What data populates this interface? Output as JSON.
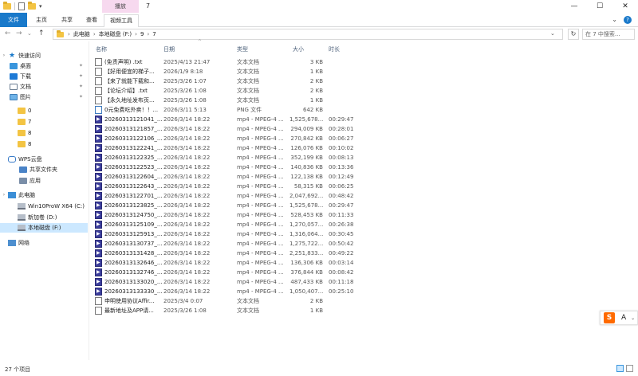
{
  "window": {
    "title": "7",
    "minimize": "—",
    "maximize": "☐",
    "close": "✕"
  },
  "ribbon": {
    "file_tab": "文件",
    "home_tab": "主页",
    "share_tab": "共享",
    "view_tab": "查看",
    "context_group": "播放",
    "video_tools_tab": "视频工具",
    "collapse": "⌄",
    "help": "?"
  },
  "address": {
    "back": "←",
    "forward": "→",
    "recent": "⌄",
    "up": "↑",
    "crumbs": [
      "此电脑",
      "本地磁盘 (F:)",
      "9",
      "7"
    ],
    "dropdown": "⌄",
    "refresh": "↻",
    "search_placeholder": "在 7 中搜索..."
  },
  "nav": {
    "quick_access": "快速访问",
    "desktop": "桌面",
    "downloads": "下载",
    "documents": "文档",
    "pictures": "图片",
    "folders": [
      "0",
      "7",
      "8",
      "8"
    ],
    "wps_cloud": "WPS云盘",
    "shared_folder": "共享文件夹",
    "apps": "应用",
    "this_pc": "此电脑",
    "drive_c": "Win10ProW X64 (C:)",
    "drive_d": "新加卷 (D:)",
    "drive_f": "本地磁盘 (F:)",
    "network": "网络"
  },
  "columns": {
    "name": "名称",
    "date": "日期",
    "type": "类型",
    "size": "大小",
    "length": "时长"
  },
  "files": [
    {
      "name": "(免责声明) .txt",
      "date": "2025/4/13 21:47",
      "type": "文本文档",
      "size": "3 KB",
      "length": "",
      "kind": "txt"
    },
    {
      "name": "【好用便宜的梯子...",
      "date": "2026/1/9 8:18",
      "type": "文本文档",
      "size": "1 KB",
      "length": "",
      "kind": "txt"
    },
    {
      "name": "【来了就能下载和...",
      "date": "2025/3/26 1:07",
      "type": "文本文档",
      "size": "2 KB",
      "length": "",
      "kind": "txt"
    },
    {
      "name": "【论坛介绍】.txt",
      "date": "2025/3/26 1:08",
      "type": "文本文档",
      "size": "2 KB",
      "length": "",
      "kind": "txt"
    },
    {
      "name": "【永久地址发布页...",
      "date": "2025/3/26 1:08",
      "type": "文本文档",
      "size": "1 KB",
      "length": "",
      "kind": "txt"
    },
    {
      "name": "0元免费吃外卖！！...",
      "date": "2026/3/11 5:13",
      "type": "PNG 文件",
      "size": "642 KB",
      "length": "",
      "kind": "png"
    },
    {
      "name": "20260313121041_...",
      "date": "2026/3/14 18:22",
      "type": "mp4 - MPEG-4 ...",
      "size": "1,525,678...",
      "length": "00:29:47",
      "kind": "mp4"
    },
    {
      "name": "20260313121857_...",
      "date": "2026/3/14 18:22",
      "type": "mp4 - MPEG-4 ...",
      "size": "294,009 KB",
      "length": "00:28:01",
      "kind": "mp4"
    },
    {
      "name": "20260313122106_...",
      "date": "2026/3/14 18:22",
      "type": "mp4 - MPEG-4 ...",
      "size": "270,842 KB",
      "length": "00:06:27",
      "kind": "mp4"
    },
    {
      "name": "20260313122241_...",
      "date": "2026/3/14 18:22",
      "type": "mp4 - MPEG-4 ...",
      "size": "126,076 KB",
      "length": "00:10:02",
      "kind": "mp4"
    },
    {
      "name": "20260313122325_...",
      "date": "2026/3/14 18:22",
      "type": "mp4 - MPEG-4 ...",
      "size": "352,199 KB",
      "length": "00:08:13",
      "kind": "mp4"
    },
    {
      "name": "20260313122523_...",
      "date": "2026/3/14 18:22",
      "type": "mp4 - MPEG-4 ...",
      "size": "140,836 KB",
      "length": "00:13:36",
      "kind": "mp4"
    },
    {
      "name": "20260313122604_...",
      "date": "2026/3/14 18:22",
      "type": "mp4 - MPEG-4 ...",
      "size": "122,138 KB",
      "length": "00:12:49",
      "kind": "mp4"
    },
    {
      "name": "20260313122643_...",
      "date": "2026/3/14 18:22",
      "type": "mp4 - MPEG-4 ...",
      "size": "58,315 KB",
      "length": "00:06:25",
      "kind": "mp4"
    },
    {
      "name": "20260313122701_...",
      "date": "2026/3/14 18:22",
      "type": "mp4 - MPEG-4 ...",
      "size": "2,047,692...",
      "length": "00:48:42",
      "kind": "mp4"
    },
    {
      "name": "20260313123825_...",
      "date": "2026/3/14 18:22",
      "type": "mp4 - MPEG-4 ...",
      "size": "1,525,678...",
      "length": "00:29:47",
      "kind": "mp4"
    },
    {
      "name": "20260313124750_...",
      "date": "2026/3/14 18:22",
      "type": "mp4 - MPEG-4 ...",
      "size": "528,453 KB",
      "length": "00:11:33",
      "kind": "mp4"
    },
    {
      "name": "20260313125109_...",
      "date": "2026/3/14 18:22",
      "type": "mp4 - MPEG-4 ...",
      "size": "1,270,057...",
      "length": "00:26:38",
      "kind": "mp4"
    },
    {
      "name": "20260313125913_...",
      "date": "2026/3/14 18:22",
      "type": "mp4 - MPEG-4 ...",
      "size": "1,316,064...",
      "length": "00:30:45",
      "kind": "mp4"
    },
    {
      "name": "20260313130737_...",
      "date": "2026/3/14 18:22",
      "type": "mp4 - MPEG-4 ...",
      "size": "1,275,722...",
      "length": "00:50:42",
      "kind": "mp4"
    },
    {
      "name": "20260313131428_...",
      "date": "2026/3/14 18:22",
      "type": "mp4 - MPEG-4 ...",
      "size": "2,251,833...",
      "length": "00:49:22",
      "kind": "mp4"
    },
    {
      "name": "20260313132646_...",
      "date": "2026/3/14 18:22",
      "type": "mp4 - MPEG-4 ...",
      "size": "136,306 KB",
      "length": "00:03:14",
      "kind": "mp4"
    },
    {
      "name": "20260313132746_...",
      "date": "2026/3/14 18:22",
      "type": "mp4 - MPEG-4 ...",
      "size": "376,844 KB",
      "length": "00:08:42",
      "kind": "mp4"
    },
    {
      "name": "20260313133020_...",
      "date": "2026/3/14 18:22",
      "type": "mp4 - MPEG-4 ...",
      "size": "487,433 KB",
      "length": "00:11:18",
      "kind": "mp4"
    },
    {
      "name": "20260313133330_...",
      "date": "2026/3/14 18:22",
      "type": "mp4 - MPEG-4 ...",
      "size": "1,050,407...",
      "length": "00:25:10",
      "kind": "mp4"
    },
    {
      "name": "申明使用协议Affir...",
      "date": "2025/3/4 0:07",
      "type": "文本文档",
      "size": "2 KB",
      "length": "",
      "kind": "txt"
    },
    {
      "name": "最新地址及APP请...",
      "date": "2025/3/26 1:08",
      "type": "文本文档",
      "size": "1 KB",
      "length": "",
      "kind": "txt"
    }
  ],
  "status": {
    "item_count": "27 个项目"
  },
  "ime": {
    "logo": "S",
    "language": "A",
    "options": "⌄"
  },
  "colors": {
    "file_tab": "#1979ca",
    "context_tab": "#f7d9ef",
    "selection": "#cce8ff"
  }
}
